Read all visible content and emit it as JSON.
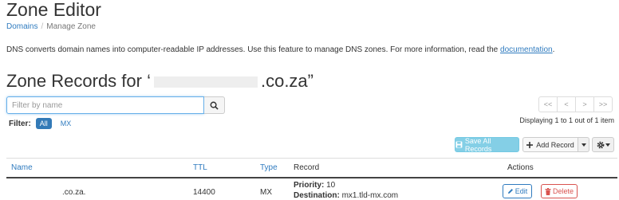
{
  "page": {
    "title": "Zone Editor",
    "breadcrumb": {
      "parent": "Domains",
      "separator": "/",
      "current": "Manage Zone"
    },
    "description": "DNS converts domain names into computer-readable IP addresses. Use this feature to manage DNS zones. For more information, read the ",
    "description_link": "documentation",
    "description_end": "."
  },
  "heading": {
    "prefix": "Zone Records for ‘",
    "suffix": ".co.za”"
  },
  "search": {
    "placeholder": "Filter by name",
    "value": ""
  },
  "filter": {
    "label": "Filter:",
    "options": [
      "All",
      "MX"
    ],
    "active": "All"
  },
  "pager": {
    "buttons": [
      "<<",
      "<",
      ">",
      ">>"
    ],
    "status": "Displaying 1 to 1 out of 1 item"
  },
  "toolbar": {
    "save_all": "Save All Records",
    "add_record": "Add Record"
  },
  "table": {
    "columns": [
      "Name",
      "TTL",
      "Type",
      "Record",
      "Actions"
    ],
    "rows": [
      {
        "name": ".co.za.",
        "ttl": "14400",
        "type": "MX",
        "priority_label": "Priority:",
        "priority": "10",
        "destination_label": "Destination:",
        "destination": "mx1.tld-mx.com",
        "edit": "Edit",
        "delete": "Delete"
      }
    ]
  },
  "colors": {
    "link": "#2f7bbf",
    "info": "#5bc0de",
    "danger": "#d9534f",
    "primary": "#337ab7"
  },
  "icons": [
    "search-icon",
    "save-icon",
    "plus-icon",
    "gear-icon",
    "pencil-icon",
    "trash-icon",
    "chevron-down-icon"
  ]
}
